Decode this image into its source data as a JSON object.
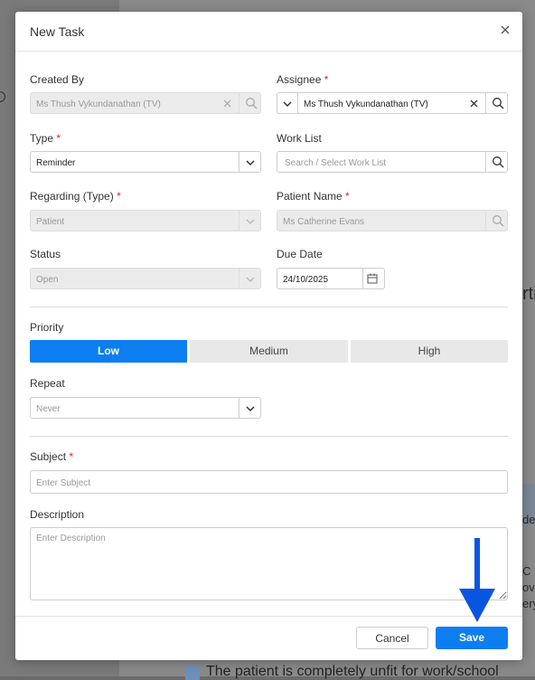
{
  "background": {
    "right_snippets": [
      "rti",
      "de",
      "C",
      "ov-u",
      "ery"
    ],
    "bottom_text": "The patient is completely unfit for work/school"
  },
  "modal": {
    "title": "New Task",
    "close_icon": "close-icon"
  },
  "form": {
    "created_by": {
      "label": "Created By",
      "value": "Ms Thush Vykundanathan (TV)"
    },
    "assignee": {
      "label": "Assignee",
      "required_mark": "*",
      "value": "Ms Thush Vykundanathan (TV)"
    },
    "type": {
      "label": "Type",
      "required_mark": "*",
      "value": "Reminder"
    },
    "work_list": {
      "label": "Work List",
      "placeholder": "Search / Select Work List"
    },
    "regarding_type": {
      "label": "Regarding (Type)",
      "required_mark": "*",
      "value": "Patient"
    },
    "patient_name": {
      "label": "Patient Name",
      "required_mark": "*",
      "value": "Ms Catherine Evans"
    },
    "status": {
      "label": "Status",
      "value": "Open"
    },
    "due_date": {
      "label": "Due Date",
      "value": "24/10/2025"
    },
    "priority": {
      "label": "Priority",
      "options": [
        "Low",
        "Medium",
        "High"
      ],
      "selected": "Low"
    },
    "repeat": {
      "label": "Repeat",
      "value": "Never"
    },
    "subject": {
      "label": "Subject",
      "required_mark": "*",
      "placeholder": "Enter Subject"
    },
    "description": {
      "label": "Description",
      "placeholder": "Enter Description"
    }
  },
  "footer": {
    "cancel_label": "Cancel",
    "save_label": "Save"
  },
  "colors": {
    "accent": "#0c7ef0",
    "required": "#e02424",
    "annotation_arrow": "#0a55e0"
  }
}
